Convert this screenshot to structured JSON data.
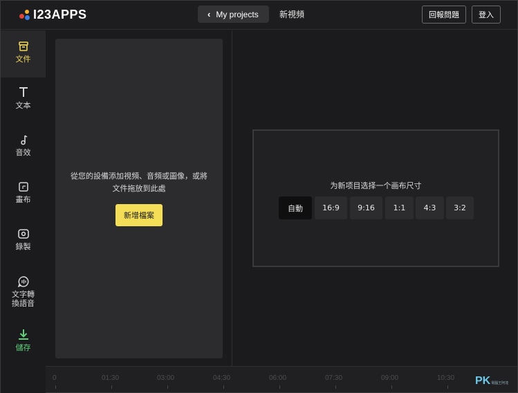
{
  "header": {
    "logo_text": "I23APPS",
    "back_label": "My projects",
    "project_title": "新視頻",
    "report_label": "回報問題",
    "login_label": "登入"
  },
  "sidebar": {
    "items": [
      {
        "label": "文件",
        "icon": "files-icon"
      },
      {
        "label": "文本",
        "icon": "text-icon"
      },
      {
        "label": "音效",
        "icon": "music-note-icon"
      },
      {
        "label": "畫布",
        "icon": "canvas-icon"
      },
      {
        "label": "錄製",
        "icon": "record-icon"
      },
      {
        "label_line1": "文字轉",
        "label_line2": "換語音",
        "icon": "text-to-speech-icon"
      },
      {
        "label": "儲存",
        "icon": "download-icon"
      }
    ]
  },
  "media_panel": {
    "hint_line1": "從您的設備添加視頻、音頻或圖像，或將",
    "hint_line2": "文件拖放到此處",
    "add_button": "新增檔案"
  },
  "canvas": {
    "prompt": "为新项目选择一个画布尺寸",
    "ratios": [
      "自動",
      "16:9",
      "9:16",
      "1:1",
      "4:3",
      "3:2"
    ],
    "selected": "自動"
  },
  "timeline": {
    "ticks": [
      "0",
      "01:30",
      "03:00",
      "04:30",
      "06:00",
      "07:30",
      "09:00",
      "10:30"
    ]
  },
  "watermark": {
    "text": "PK",
    "small": "電腦王阿達"
  },
  "colors": {
    "accent_yellow": "#f4de58",
    "active_text": "#f0d65a",
    "save_green": "#5fd17a",
    "background": "#1b1b1d"
  }
}
